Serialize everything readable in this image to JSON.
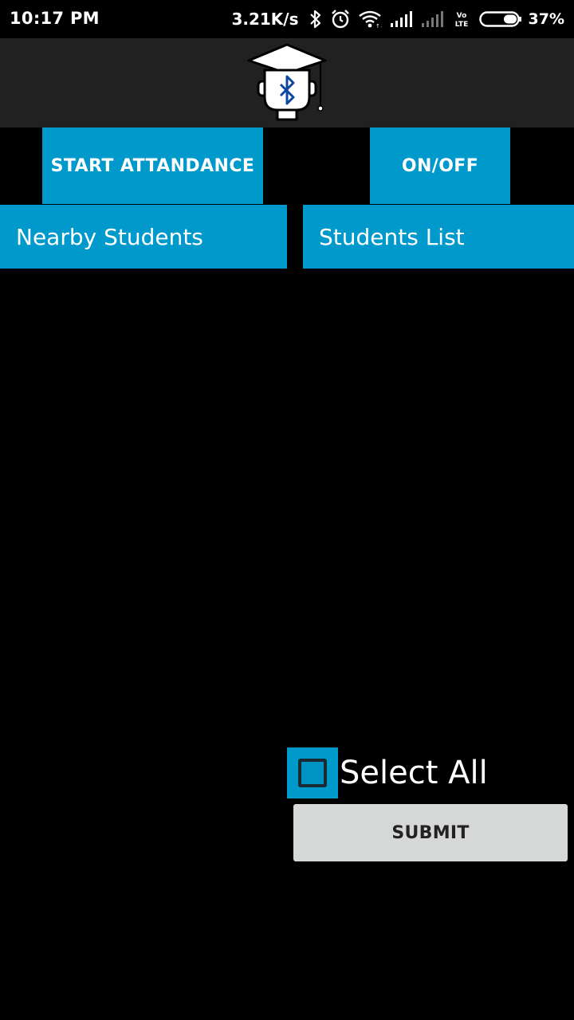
{
  "status_bar": {
    "time": "10:17 PM",
    "network_speed": "3.21K/s",
    "battery_percent": "37%",
    "battery_level": 0.37,
    "icons": [
      "bluetooth-icon",
      "alarm-icon",
      "wifi-icon",
      "signal-icon",
      "signal-icon-2",
      "volte-icon",
      "battery-icon"
    ],
    "volte_label": "VoLTE"
  },
  "toolbar": {
    "logo_icon": "graduate-bluetooth-logo-icon"
  },
  "buttons": {
    "start_attendance": "START ATTANDANCE",
    "on_off": "ON/OFF",
    "submit": "SUBMIT"
  },
  "headers": {
    "nearby_students": "Nearby Students",
    "students_list": "Students List"
  },
  "select_all": {
    "label": "Select All",
    "checked": false
  },
  "colors": {
    "accent": "#0099cc",
    "toolbar_bg": "#212121",
    "background": "#000000",
    "submit_bg": "#d6d7d7"
  }
}
